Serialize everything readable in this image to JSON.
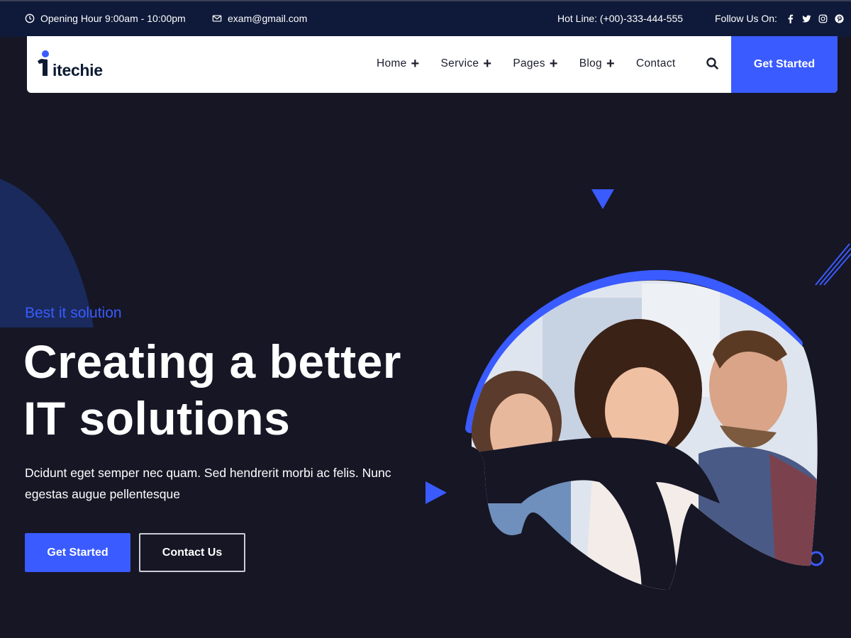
{
  "topbar": {
    "opening_hours": "Opening Hour 9:00am - 10:00pm",
    "email": "exam@gmail.com",
    "hotline": "Hot Line: (+00)-333-444-555",
    "follow_label": "Follow Us On:",
    "social_icons": [
      "facebook-icon",
      "twitter-icon",
      "instagram-icon",
      "pinterest-icon"
    ]
  },
  "nav": {
    "logo": "itechie",
    "items": [
      {
        "label": "Home",
        "has_submenu": true
      },
      {
        "label": "Service",
        "has_submenu": true
      },
      {
        "label": "Pages",
        "has_submenu": true
      },
      {
        "label": "Blog",
        "has_submenu": true
      },
      {
        "label": "Contact",
        "has_submenu": false
      }
    ],
    "cta": "Get Started"
  },
  "hero": {
    "eyebrow": "Best it solution",
    "title_line1": "Creating a better",
    "title_line2": "IT solutions",
    "description": "Dcidunt eget semper nec quam. Sed hendrerit morbi ac felis. Nunc egestas augue pellentesque",
    "primary_button": "Get Started",
    "secondary_button": "Contact Us"
  },
  "colors": {
    "accent": "#3a5bff",
    "background": "#161625",
    "topbar": "#0f1a3a"
  }
}
